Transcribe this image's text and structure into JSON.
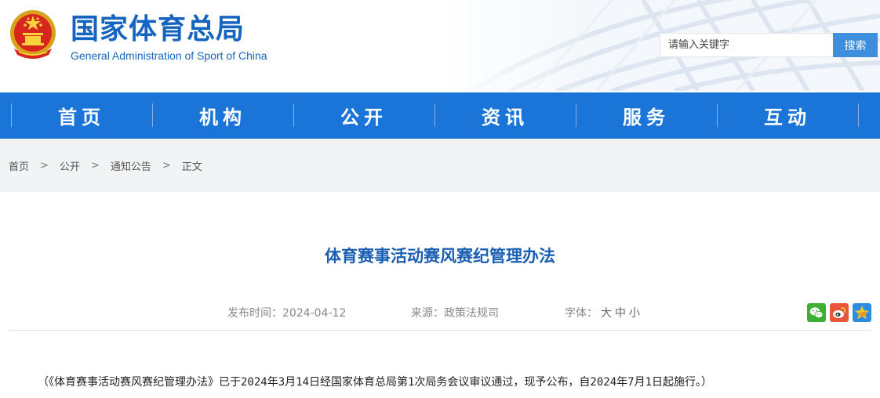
{
  "header": {
    "org_name_cn": "国家体育总局",
    "org_name_en": "General Administration of Sport of China",
    "logo_icon": "national-emblem-icon"
  },
  "search": {
    "placeholder": "请输入关键字",
    "button_label": "搜索"
  },
  "nav": {
    "items": [
      {
        "label": "首页"
      },
      {
        "label": "机构"
      },
      {
        "label": "公开"
      },
      {
        "label": "资讯"
      },
      {
        "label": "服务"
      },
      {
        "label": "互动"
      }
    ]
  },
  "breadcrumb": {
    "items": [
      "首页",
      "公开",
      "通知公告",
      "正文"
    ],
    "separator": ">"
  },
  "article": {
    "title": "体育赛事活动赛风赛纪管理办法",
    "meta": {
      "date_label": "发布时间：",
      "date": "2024-04-12",
      "source_label": "来源：",
      "source": "政策法规司",
      "font_label": "字体：",
      "font_large": "大",
      "font_medium": "中",
      "font_small": "小"
    },
    "share_icons": [
      "wechat-icon",
      "weibo-icon",
      "qzone-icon"
    ],
    "intro": "（《体育赛事活动赛风赛纪管理办法》已于2024年3月14日经国家体育总局第1次局务会议审议通过，现予公布，自2024年7月1日起施行。）"
  },
  "colors": {
    "brand_blue": "#1565c0",
    "nav_blue": "#1b74d7",
    "title_blue": "#1a5fb4",
    "search_button": "#3e8ede",
    "crumb_bg": "#f2f3f5"
  }
}
